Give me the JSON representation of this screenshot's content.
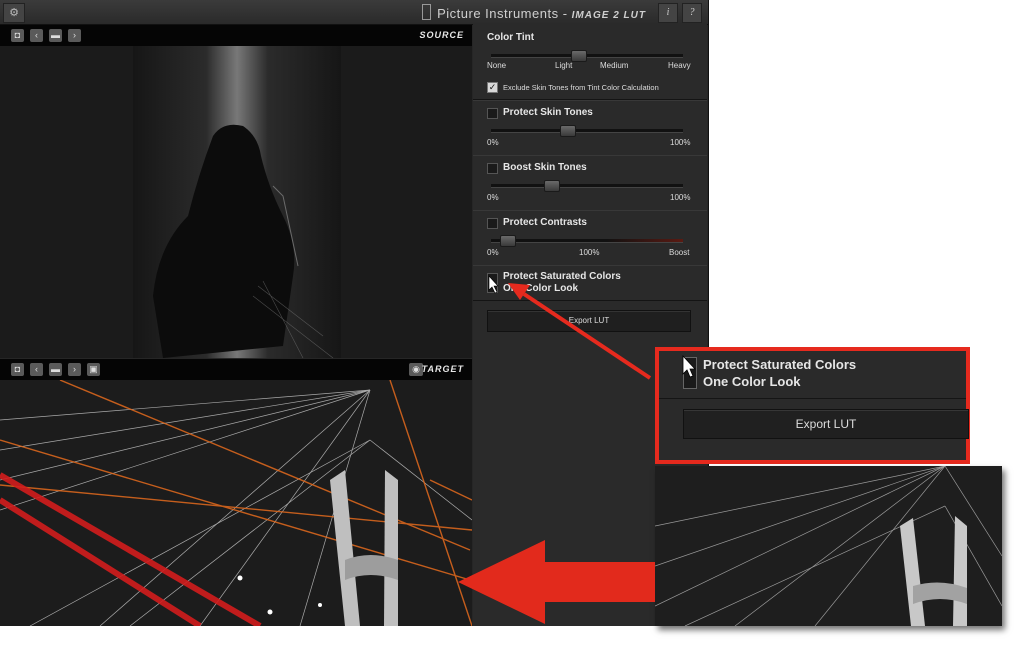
{
  "titlebar": {
    "brand": "Picture Instruments -",
    "product": "IMAGE 2 LUT",
    "info_label": "i",
    "help_label": "?",
    "settings_icon": "gear-icon"
  },
  "source": {
    "label": "SOURCE"
  },
  "target": {
    "label": "TARGET"
  },
  "panel": {
    "color_tint": {
      "title": "Color Tint",
      "ticks": [
        "None",
        "Light",
        "Medium",
        "Heavy"
      ],
      "value": 0.45,
      "exclude_label": "Exclude Skin Tones from Tint Color Calculation",
      "exclude_checked": true
    },
    "protect_skin": {
      "title": "Protect Skin Tones",
      "min": "0%",
      "max": "100%",
      "value": 0.39
    },
    "boost_skin": {
      "title": "Boost Skin Tones",
      "min": "0%",
      "max": "100%",
      "value": 0.3
    },
    "protect_contrasts": {
      "title": "Protect Contrasts",
      "min": "0%",
      "mid": "100%",
      "max": "Boost",
      "value": 0.05
    },
    "saturated": {
      "title": "Protect Saturated Colors",
      "one_color": "One Color Look"
    },
    "export_label": "Export LUT"
  },
  "callout": {
    "title": "Protect Saturated Colors",
    "subtitle": "One Color Look",
    "export_label": "Export LUT"
  },
  "colors": {
    "accent": "#e62a1e",
    "panel_bg": "#2a2a2a"
  }
}
